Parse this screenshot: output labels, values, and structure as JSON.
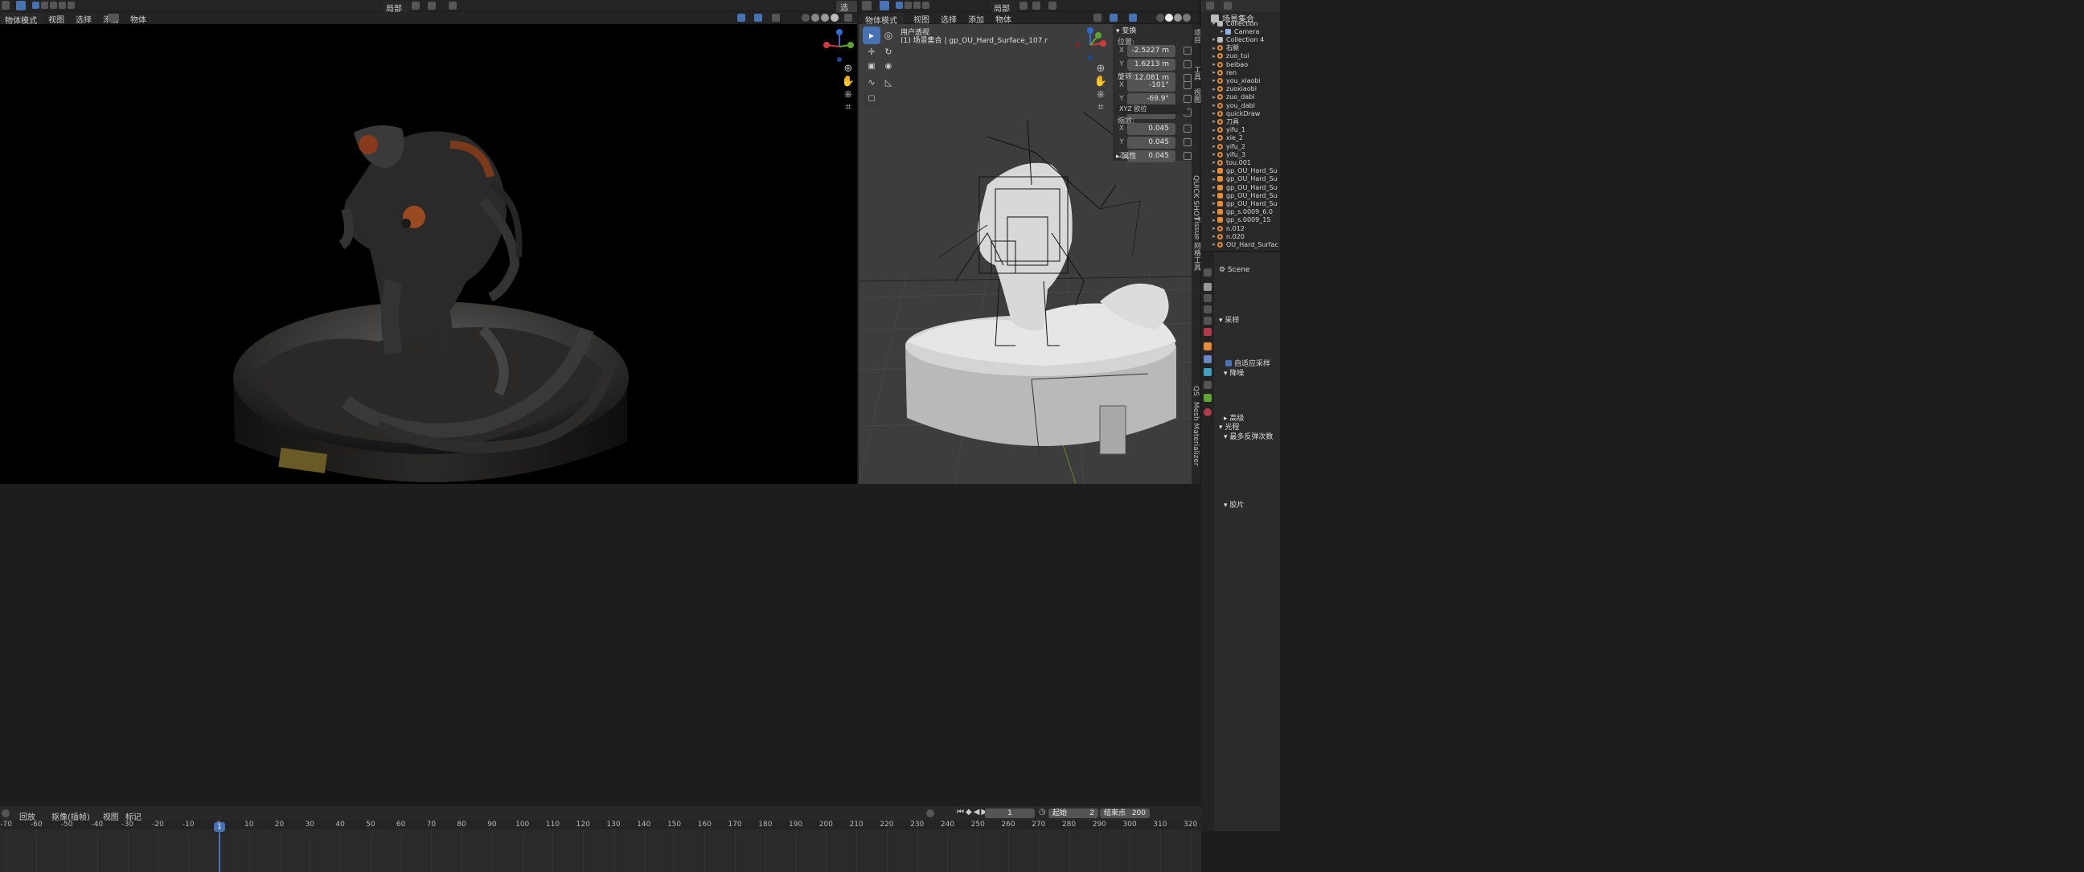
{
  "left_viewport": {
    "header": {
      "mode": "物体模式",
      "menus": [
        "视图",
        "选择",
        "添加",
        "物体"
      ],
      "transform_orientation": "局部",
      "options": "选项"
    }
  },
  "right_viewport": {
    "header": {
      "mode": "物体模式",
      "menus": [
        "视图",
        "选择",
        "添加",
        "物体"
      ],
      "transform_orientation": "局部",
      "options": "选项"
    },
    "overlay_title": "用户透视",
    "overlay_subtitle": "(1) 场景集合 | gp_OU_Hard_Surface_107.r"
  },
  "n_panel": {
    "section_transform": "变换",
    "location_label": "位置:",
    "location": [
      {
        "axis": "X",
        "value": "-2.5227 m"
      },
      {
        "axis": "Y",
        "value": "1.6213 m"
      },
      {
        "axis": "Z",
        "value": "12.081 m"
      }
    ],
    "rotation_label": "旋转:",
    "rotation": [
      {
        "axis": "X",
        "value": "-101°"
      },
      {
        "axis": "Y",
        "value": "-69.9°"
      },
      {
        "axis": "Z",
        "value": "80.9°"
      }
    ],
    "rotation_mode": "XYZ 欧拉",
    "scale_label": "缩放:",
    "scale": [
      {
        "axis": "X",
        "value": "0.045"
      },
      {
        "axis": "Y",
        "value": "0.045"
      },
      {
        "axis": "Z",
        "value": "0.045"
      }
    ],
    "section_properties": "属性"
  },
  "side_tabs": [
    "项目",
    "工具",
    "视图",
    "QUICK SHOT",
    "Tissue 网格工具",
    "Mesh Materializer",
    "QS"
  ],
  "outliner": {
    "root": "场景集合",
    "items": [
      {
        "name": "Collection",
        "type": "coll",
        "indent": 1
      },
      {
        "name": "Camera",
        "type": "cam",
        "indent": 2
      },
      {
        "name": "Collection 4",
        "type": "coll",
        "indent": 1
      },
      {
        "name": "右腿",
        "type": "obj",
        "indent": 1
      },
      {
        "name": "zuo_tui",
        "type": "obj",
        "indent": 1
      },
      {
        "name": "beibao",
        "type": "obj",
        "indent": 1
      },
      {
        "name": "ren",
        "type": "obj",
        "indent": 1
      },
      {
        "name": "you_xiaobi",
        "type": "obj",
        "indent": 1
      },
      {
        "name": "zuoxiaobi",
        "type": "obj",
        "indent": 1
      },
      {
        "name": "zuo_dabi",
        "type": "obj",
        "indent": 1
      },
      {
        "name": "you_dabi",
        "type": "obj",
        "indent": 1
      },
      {
        "name": "quickDraw",
        "type": "obj",
        "indent": 1
      },
      {
        "name": "刀具",
        "type": "obj",
        "indent": 1
      },
      {
        "name": "yifu_1",
        "type": "obj",
        "indent": 1
      },
      {
        "name": "xie_2",
        "type": "obj",
        "indent": 1
      },
      {
        "name": "yifu_2",
        "type": "obj",
        "indent": 1
      },
      {
        "name": "yifu_3",
        "type": "obj",
        "indent": 1
      },
      {
        "name": "tou.001",
        "type": "obj",
        "indent": 1
      },
      {
        "name": "gp_OU_Hard_Su",
        "type": "gp",
        "indent": 1
      },
      {
        "name": "gp_OU_Hard_Su",
        "type": "gp",
        "indent": 1
      },
      {
        "name": "gp_OU_Hard_Su",
        "type": "gp",
        "indent": 1
      },
      {
        "name": "gp_OU_Hard_Su",
        "type": "gp",
        "indent": 1
      },
      {
        "name": "gp_OU_Hard_Su",
        "type": "gp",
        "indent": 1
      },
      {
        "name": "gp_s.0009_6.0",
        "type": "gp",
        "indent": 1
      },
      {
        "name": "gp_s.0009_15",
        "type": "gp",
        "indent": 1
      },
      {
        "name": "n.012",
        "type": "obj",
        "indent": 1
      },
      {
        "name": "n.020",
        "type": "obj",
        "indent": 1
      },
      {
        "name": "OU_Hard_Surfac",
        "type": "obj",
        "indent": 1
      }
    ]
  },
  "properties": {
    "scene": "Scene",
    "sampling": "采样",
    "adaptive_sampling": "自适应采样",
    "denoise": "降噪",
    "advanced": "高级",
    "light_paths": "光程",
    "max_bounces": "最多反弹次数",
    "film": "胶片"
  },
  "timeline": {
    "menus": [
      "回放",
      "抠像(插帧)",
      "视图",
      "标记"
    ],
    "current_frame": "1",
    "start_label": "起始",
    "start": "2",
    "end_label": "结束点",
    "end": "200",
    "ticks": [
      "-70",
      "-60",
      "-50",
      "-40",
      "-30",
      "-20",
      "-10",
      "0",
      "10",
      "20",
      "30",
      "40",
      "50",
      "60",
      "70",
      "80",
      "90",
      "100",
      "110",
      "120",
      "130",
      "140",
      "150",
      "160",
      "170",
      "180",
      "190",
      "200",
      "210",
      "220",
      "230",
      "240",
      "250",
      "260",
      "270",
      "280",
      "290",
      "300",
      "310",
      "320"
    ]
  }
}
